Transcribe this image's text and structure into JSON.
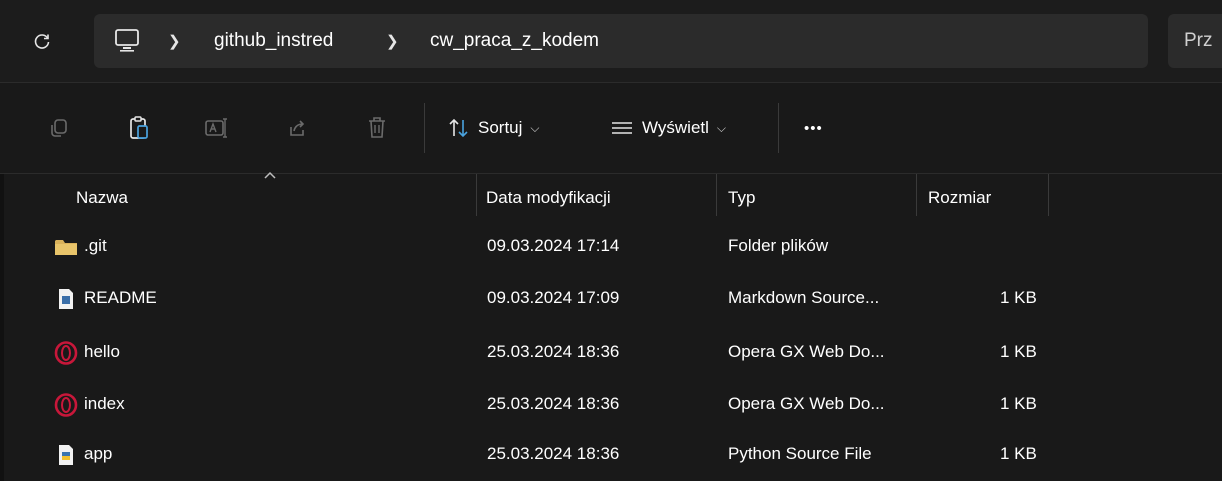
{
  "address_bar": {
    "breadcrumbs": [
      "github_instred",
      "cw_praca_z_kodem"
    ],
    "search_placeholder": "Prz"
  },
  "toolbar": {
    "sort_label": "Sortuj",
    "view_label": "Wyświetl",
    "more_label": "•••"
  },
  "columns": {
    "name": "Nazwa",
    "modified": "Data modyfikacji",
    "type": "Typ",
    "size": "Rozmiar"
  },
  "files": [
    {
      "name": ".git",
      "modified": "09.03.2024 17:14",
      "type": "Folder plików",
      "size": "",
      "icon": "folder-icon"
    },
    {
      "name": "README",
      "modified": "09.03.2024 17:09",
      "type": "Markdown Source...",
      "size": "1 KB",
      "icon": "markdown-file-icon"
    },
    {
      "name": "hello",
      "modified": "25.03.2024 18:36",
      "type": "Opera GX Web Do...",
      "size": "1 KB",
      "icon": "opera-gx-icon"
    },
    {
      "name": "index",
      "modified": "25.03.2024 18:36",
      "type": "Opera GX Web Do...",
      "size": "1 KB",
      "icon": "opera-gx-icon"
    },
    {
      "name": "app",
      "modified": "25.03.2024 18:36",
      "type": "Python Source File",
      "size": "1 KB",
      "icon": "python-file-icon"
    }
  ],
  "colors": {
    "background": "#191919",
    "folder": "#d9b15a",
    "opera": "#c8173a"
  }
}
